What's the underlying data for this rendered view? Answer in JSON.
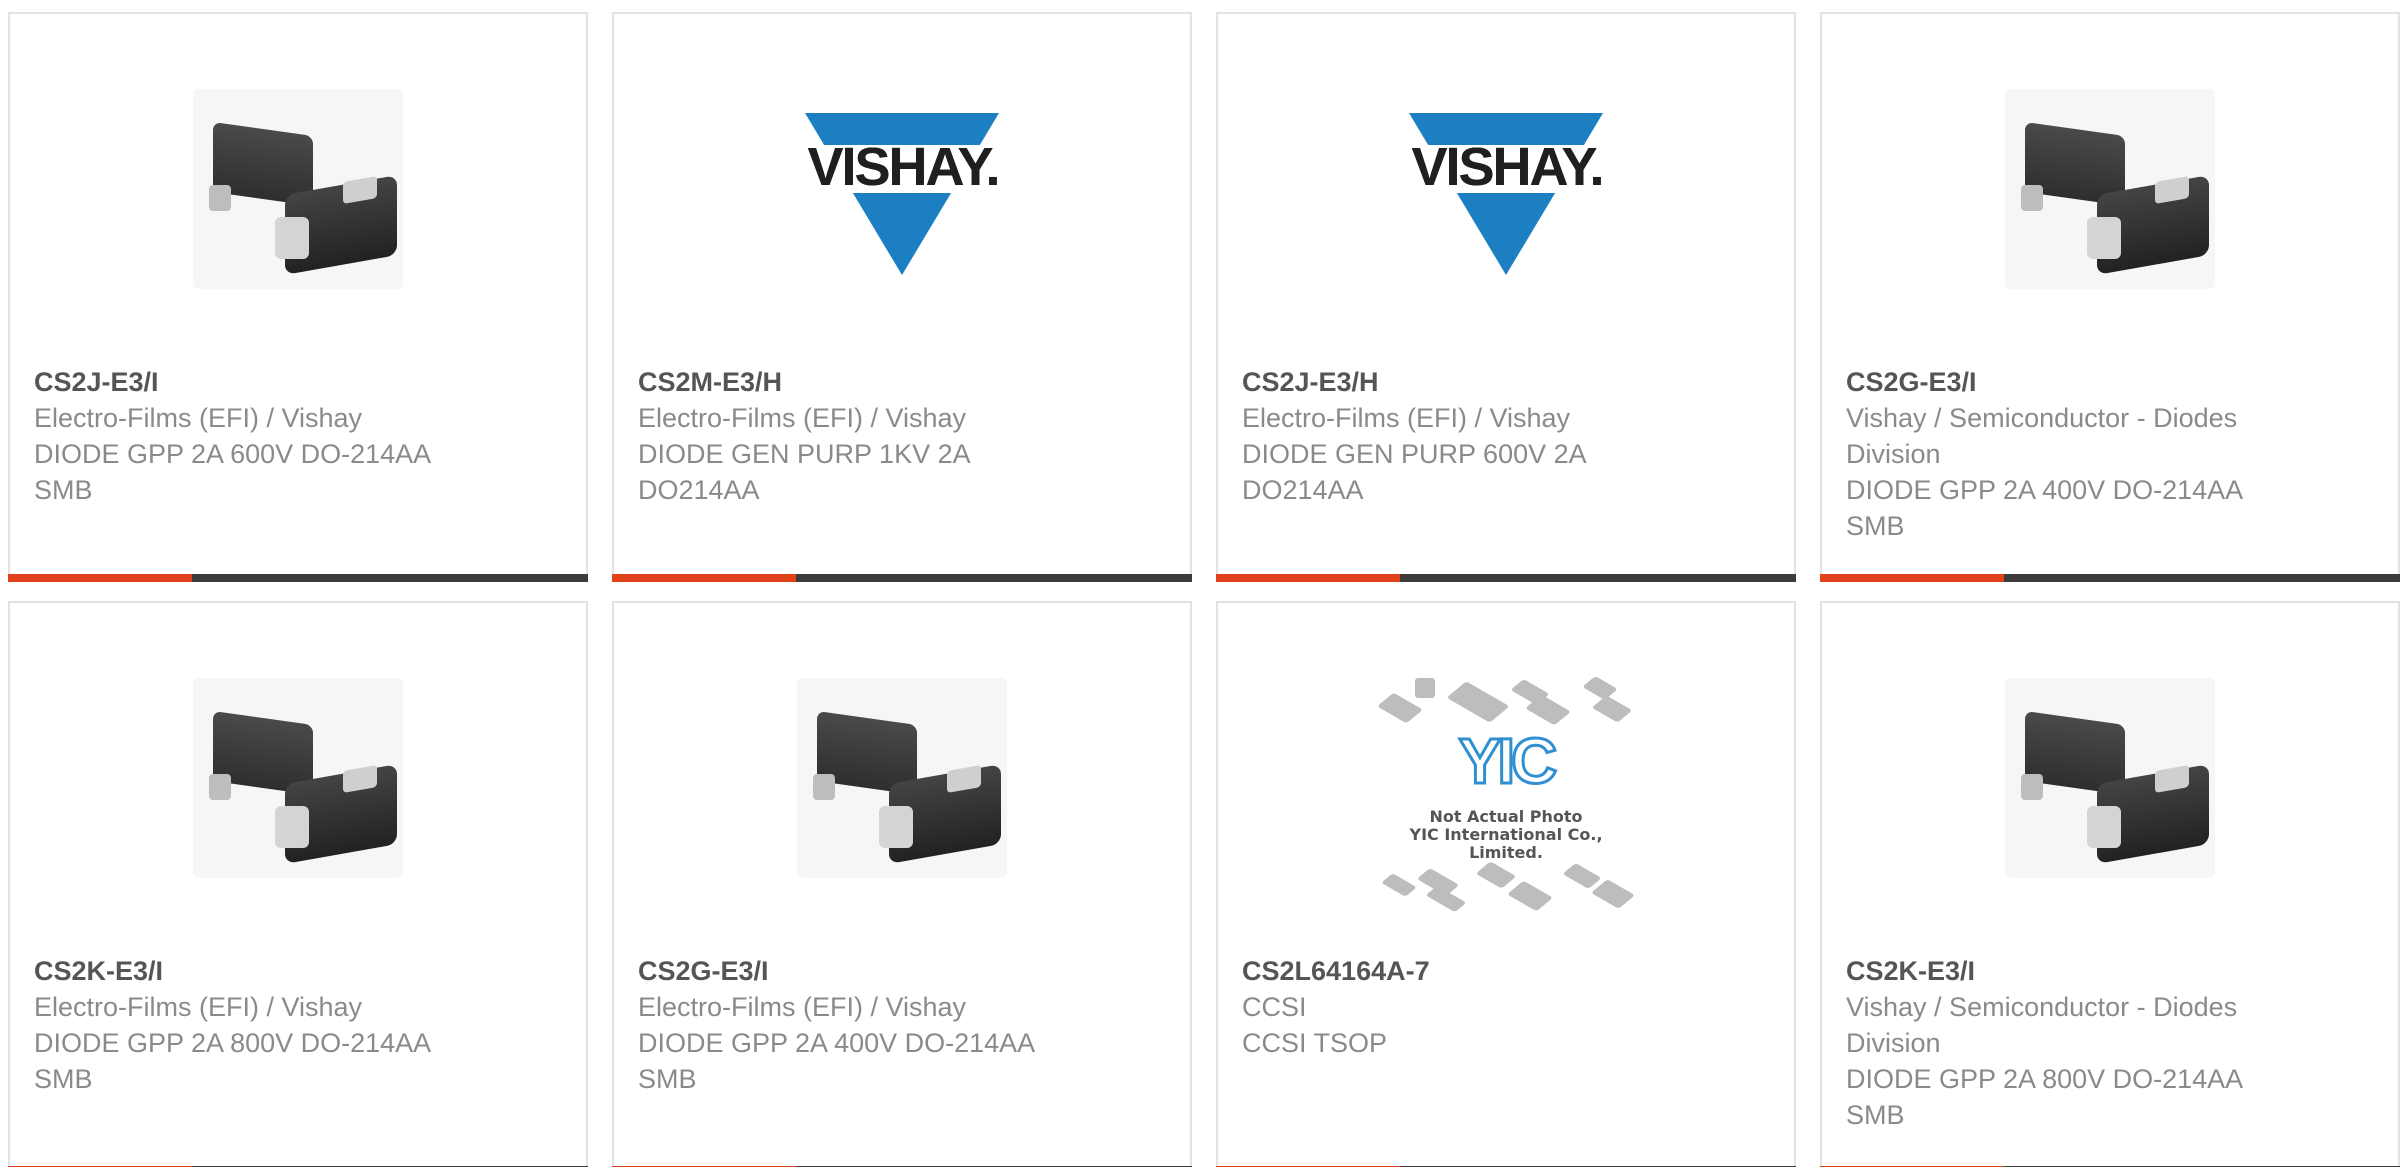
{
  "products": [
    {
      "part": "CS2J-E3/I",
      "maker": "Electro-Films (EFI) / Vishay",
      "desc": "DIODE GPP 2A 600V DO-214AA SMB",
      "image": "diode-package-image"
    },
    {
      "part": "CS2M-E3/H",
      "maker": "Electro-Films (EFI) / Vishay",
      "desc": "DIODE GEN PURP 1KV 2A DO214AA",
      "image": "vishay-logo"
    },
    {
      "part": "CS2J-E3/H",
      "maker": "Electro-Films (EFI) / Vishay",
      "desc": "DIODE GEN PURP 600V 2A DO214AA",
      "image": "vishay-logo"
    },
    {
      "part": "CS2G-E3/I",
      "maker": "Vishay / Semiconductor - Diodes Division",
      "desc": "DIODE GPP 2A 400V DO-214AA SMB",
      "image": "diode-package-image"
    },
    {
      "part": "CS2K-E3/I",
      "maker": "Electro-Films (EFI) / Vishay",
      "desc": "DIODE GPP 2A 800V DO-214AA SMB",
      "image": "diode-package-image"
    },
    {
      "part": "CS2G-E3/I",
      "maker": "Electro-Films (EFI) / Vishay",
      "desc": "DIODE GPP 2A 400V DO-214AA SMB",
      "image": "diode-package-image"
    },
    {
      "part": "CS2L64164A-7",
      "maker": "CCSI",
      "desc": "CCSI TSOP",
      "image": "yic-placeholder-image"
    },
    {
      "part": "CS2K-E3/I",
      "maker": "Vishay / Semiconductor - Diodes Division",
      "desc": "DIODE GPP 2A 800V DO-214AA SMB",
      "image": "diode-package-image"
    }
  ],
  "logos": {
    "vishay_text": "VISHAY.",
    "yic_text": "YIC",
    "yic_caption_1": "Not Actual Photo",
    "yic_caption_2": "YIC International Co., Limited."
  },
  "colors": {
    "accent": "#e0401a",
    "bar": "#3c3c3c",
    "vishay_blue": "#1b7fc2",
    "text_muted": "#8a8a8a",
    "text_strong": "#555555"
  }
}
